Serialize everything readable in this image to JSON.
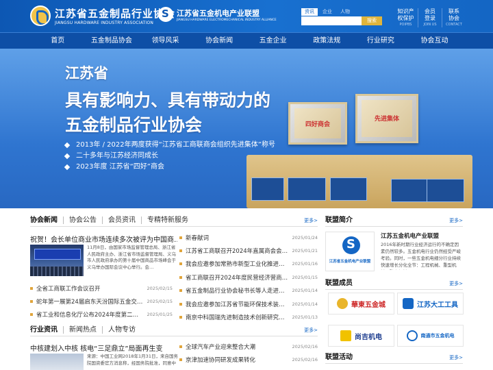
{
  "header": {
    "logo1_cn": "江苏省五金制品行业协会",
    "logo1_en": "JIANGSU HARDWARE INDUSTRY ASSOCIATION",
    "logo2_cn": "江苏省五金机电产业联盟",
    "logo2_en": "JIANGSU HARDWARE ELECTROMECHANICAL INDUSTRY ALLIANCE",
    "search_tabs": [
      "资讯",
      "企业",
      "人物"
    ],
    "search_placeholder": "",
    "search_button": "搜索",
    "quick_links": [
      {
        "l1": "知识产",
        "l2": "权保护",
        "en": "POIPBS"
      },
      {
        "l1": "会员",
        "l2": "登录",
        "en": "JOIN US"
      },
      {
        "l1": "联系",
        "l2": "协会",
        "en": "CONTACT"
      }
    ]
  },
  "nav": [
    "首页",
    "五金制品协会",
    "领导风采",
    "协会新闻",
    "五金企业",
    "政策法规",
    "行业研究",
    "协会互动"
  ],
  "banner": {
    "line1": "江苏省",
    "line2": "具有影响力、具有带动力的",
    "line3": "五金制品行业协会",
    "bullets": [
      "2013年 / 2022年两度获得“江苏省工商联商会组织先进集体”称号",
      "二十多年与江苏经济同成长",
      "2023年度 江苏省“四好”商会"
    ],
    "plaque1": "四好商会",
    "plaque2": "先进集体"
  },
  "news_section": {
    "tabs": [
      "协会新闻",
      "协会公告",
      "会员资讯",
      "专精特新服务"
    ],
    "more": "更多>",
    "feature_title": "祝贺！会长单位商业市场连续多次被评为中国商…",
    "feature_desc": "11月8日，由国家市场监督管理总局、浙江省人民政府主办、浙江省市场监督管理局、义乌市人民政府承办的第十届中国商品市场峰会于义乌举办国际会议中心举行。会…",
    "list_left": [
      {
        "title": "全省工商联工作会议召开",
        "date": "2025/02/15"
      },
      {
        "title": "蛇年第一展第24届启东天汾国际五金交易…",
        "date": "2025/02/15"
      },
      {
        "title": "省工业和信息化厅公布2024年度第二批省…",
        "date": "2025/01/25"
      }
    ],
    "list_right": [
      {
        "title": "新春献词",
        "date": "2025/01/24"
      },
      {
        "title": "江苏省工商联召开2024年直属商会会长、…",
        "date": "2025/01/21"
      },
      {
        "title": "我会应邀参加常熟市新型工业化推进大会…",
        "date": "2025/01/16"
      },
      {
        "title": "省工商联召开2024年度民营经济营商环境…",
        "date": "2025/01/15"
      },
      {
        "title": "省五金制品行业协会秘书长等人走进南京…",
        "date": "2025/01/14"
      },
      {
        "title": "我会应邀参加江苏省节能环保技术装备行…",
        "date": "2025/01/14"
      },
      {
        "title": "南京中科国瑞先进制造技术创新研究院有…",
        "date": "2025/01/13"
      }
    ]
  },
  "industry_section": {
    "tabs": [
      "行业资讯",
      "新闻热点",
      "人物专访"
    ],
    "more": "更多>",
    "feature_title": "中核建划入中核 核电“三足鼎立”局面再生变",
    "feature_desc": "来源：中国工业网2018年1月31日，来自国务院国资委官方消息称，经国务院批准，同意中",
    "list": [
      {
        "title": "全球汽车产业迎来整合大潮",
        "date": "2025/02/16"
      },
      {
        "title": "京津加速协同研发成果转化",
        "date": "2025/02/16"
      }
    ]
  },
  "alliance_intro": {
    "title": "联盟简介",
    "more": "更多>",
    "logo_text": "江苏省五金机电产业联盟",
    "name": "江苏五金机电产业联盟",
    "desc": "2016年新时期行业经济运行的不确定因素仍然较多。五金机电行业仍然经受严峻考验。同时，一些五金机电细分行业持续快速增长分化全节：工程机械、重型机械、矿山机械、…"
  },
  "alliance_members": {
    "title": "联盟成员",
    "more": "更多>",
    "members": [
      "華東五金城",
      "江苏大工工具",
      "尚吉机电",
      "南通市五金机电"
    ]
  },
  "alliance_activity": {
    "title": "联盟活动",
    "more": "更多>"
  },
  "colors": {
    "primary": "#1466c4",
    "nav": "#0e4fa6",
    "accent": "#e0b53c"
  }
}
